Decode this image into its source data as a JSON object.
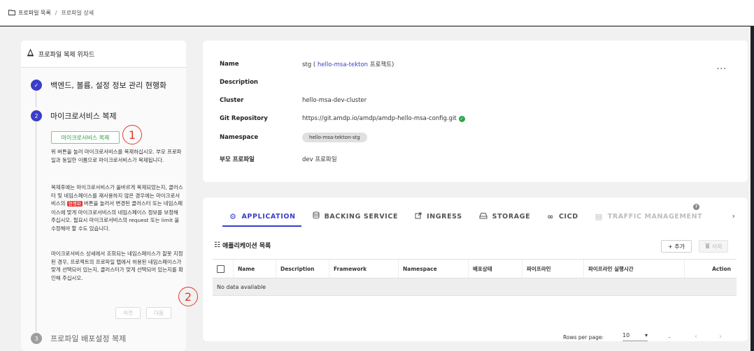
{
  "breadcrumb": {
    "icon": "folder-icon",
    "items": [
      "프로파일 목록",
      "프로파일 상세"
    ],
    "separator": "/"
  },
  "wizard": {
    "title": "프로파일 복제 위자드",
    "steps": [
      {
        "number": "✓",
        "label": "백엔드, 볼륨, 설정 정보 관리 현행화",
        "state": "done"
      },
      {
        "number": "2",
        "label": "마이크로서비스 복제",
        "state": "active"
      },
      {
        "number": "3",
        "label": "프로파일 배포설정 복제",
        "state": "pending"
      }
    ],
    "ms_button": "마이크로서비스 복제",
    "para1": "위 버튼을 눌러 마이크로서비스를 복제하십시오. 부모 프로파일과 동일한 이름으로 마이크로서비스가 복제됩니다.",
    "para2_a": "복제후에는 마이크로서비스가 올바르게 복제되었는지, 클러스터 및 네임스페이스를 재사용하지 않은 경우에는 마이크로서비스의 ",
    "para2_tag": "현행화",
    "para2_b": " 버튼을 눌러서 변경된 클러스터 또는 네임스페이스에 맞게 마이크로서비스의 네임스페이스 정보를 보정해 주십시오. 필요시 마이크로서비스의 request 또는 limit 을 수정해야 할 수도 있습니다.",
    "para3": "마이크로서비스 상세에서 조회되는 네임스페이스가 잘못 지정된 경우, 프로젝트의 프로파일 탭에서 허용된 네임스페이스가 맞게 선택되어 있는지, 클러스터가 맞게 선택되어 있는지를 확인해 주십시오.",
    "prev_button": "이전",
    "next_button": "다음",
    "callouts": [
      "1",
      "2"
    ]
  },
  "profile": {
    "name_label": "Name",
    "name_value": "stg (",
    "name_link": "hello-msa-tekton",
    "name_suffix": "프로젝트)",
    "description_label": "Description",
    "cluster_label": "Cluster",
    "cluster_value": "hello-msa-dev-cluster",
    "git_label": "Git Repository",
    "git_value": "https://git.amdp.io/amdp/amdp-hello-msa-config.git",
    "namespace_label": "Namespace",
    "namespace_value": "hello-msa-tekton-stg",
    "parent_label": "부모 프로파일",
    "parent_value": "dev 프로파일",
    "more_label": "..."
  },
  "tabs": [
    {
      "label": "APPLICATION",
      "icon": "gear-icon",
      "state": "active"
    },
    {
      "label": "BACKING SERVICE",
      "icon": "database-icon",
      "state": "normal"
    },
    {
      "label": "INGRESS",
      "icon": "external-link-icon",
      "state": "normal"
    },
    {
      "label": "STORAGE",
      "icon": "hard-drive-icon",
      "state": "normal"
    },
    {
      "label": "CICD",
      "icon": "infinity-icon",
      "state": "normal"
    },
    {
      "label": "TRAFFIC MANAGEMENT",
      "icon": "table-icon",
      "state": "disabled"
    }
  ],
  "app_list": {
    "title": "애플리케이션 목록",
    "add_button": "+ 추가",
    "delete_button": "삭제",
    "columns": [
      "Name",
      "Description",
      "Framework",
      "Namespace",
      "배포상태",
      "파이프라인",
      "파이프라인 실행시간",
      "Action"
    ],
    "empty_text": "No data available",
    "rows_per_page_label": "Rows per page:",
    "rows_per_page_value": "10",
    "range_text": "–"
  },
  "colors": {
    "accent": "#3a3ec9",
    "success": "#2e9a45",
    "danger": "#e53935",
    "callout": "#e53a2a"
  }
}
